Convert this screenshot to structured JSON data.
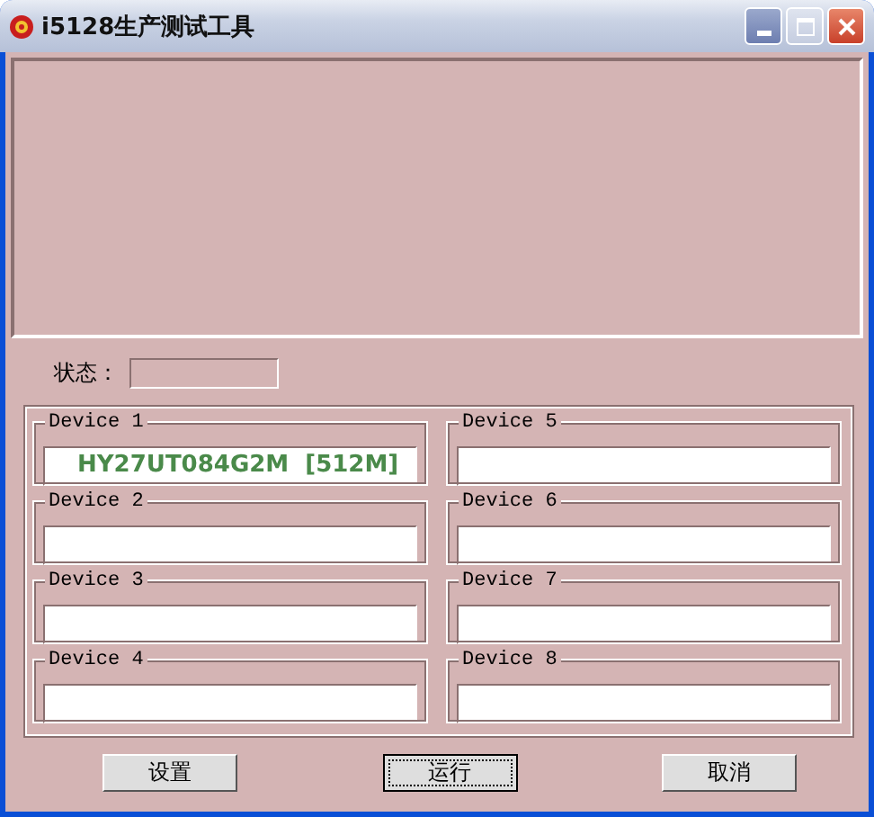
{
  "window": {
    "title": "i5128生产测试工具"
  },
  "status": {
    "label": "状态："
  },
  "devices": [
    {
      "label": "Device 1",
      "value": "HY27UT084G2M  [512M]"
    },
    {
      "label": "Device 2"
    },
    {
      "label": "Device 3"
    },
    {
      "label": "Device 4"
    },
    {
      "label": "Device 5"
    },
    {
      "label": "Device 6"
    },
    {
      "label": "Device 7"
    },
    {
      "label": "Device 8"
    }
  ],
  "buttons": [
    {
      "label": "设置",
      "default": false
    },
    {
      "label": "运行",
      "default": true
    },
    {
      "label": "取消",
      "default": false
    }
  ]
}
